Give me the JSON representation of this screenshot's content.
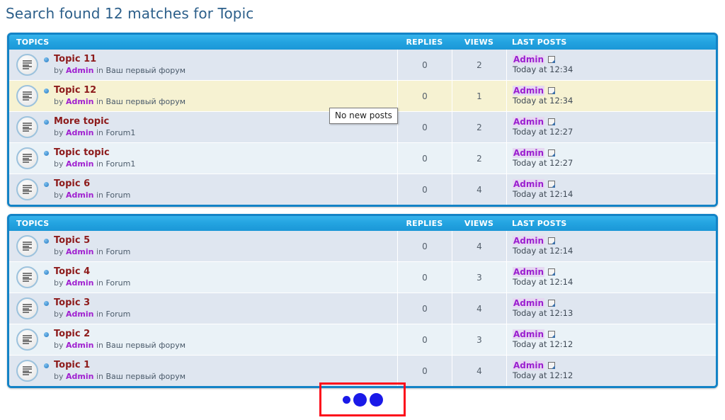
{
  "page": {
    "title": "Search found 12 matches for Topic"
  },
  "tooltip": {
    "text": "No new posts"
  },
  "columns": {
    "topics": "TOPICS",
    "replies": "REPLIES",
    "views": "VIEWS",
    "last_posts": "LAST POSTS"
  },
  "labels": {
    "by": "by",
    "in": "in"
  },
  "colors": {
    "accent": "#1383c6",
    "header_gradient_top": "#35b3ec",
    "title": "#2c5f8a",
    "topic_title": "#8d1b1b",
    "author": "#a020d0",
    "lastpost_author": "#9b1fd0",
    "row_even": "#dfe6f0",
    "row_odd": "#eaf2f7",
    "row_highlight": "#f6f2d2",
    "highlight_box": "#fc0d1b",
    "pagination_dot": "#1a19e8"
  },
  "tables": [
    {
      "id": "table-1",
      "header": "TOPICS",
      "rows": [
        {
          "icon": "topic-no-new-posts-icon",
          "title": "Topic 11",
          "author": "Admin",
          "forum": "Ваш первый форум",
          "replies": "0",
          "views": "2",
          "last_post_author": "Admin",
          "last_post_time": "Today at 12:34",
          "highlight": false
        },
        {
          "icon": "topic-no-new-posts-icon",
          "title": "Topic 12",
          "author": "Admin",
          "forum": "Ваш первый форум",
          "replies": "0",
          "views": "1",
          "last_post_author": "Admin",
          "last_post_time": "Today at 12:34",
          "highlight": true
        },
        {
          "icon": "topic-no-new-posts-icon",
          "title": "More topic",
          "author": "Admin",
          "forum": "Forum1",
          "replies": "0",
          "views": "2",
          "last_post_author": "Admin",
          "last_post_time": "Today at 12:27",
          "highlight": false
        },
        {
          "icon": "topic-no-new-posts-icon",
          "title": "Topic topic",
          "author": "Admin",
          "forum": "Forum1",
          "replies": "0",
          "views": "2",
          "last_post_author": "Admin",
          "last_post_time": "Today at 12:27",
          "highlight": false
        },
        {
          "icon": "topic-no-new-posts-icon",
          "title": "Topic 6",
          "author": "Admin",
          "forum": "Forum",
          "replies": "0",
          "views": "4",
          "last_post_author": "Admin",
          "last_post_time": "Today at 12:14",
          "highlight": false
        }
      ]
    },
    {
      "id": "table-2",
      "header": "TOPICS",
      "rows": [
        {
          "icon": "topic-no-new-posts-icon",
          "title": "Topic 5",
          "author": "Admin",
          "forum": "Forum",
          "replies": "0",
          "views": "4",
          "last_post_author": "Admin",
          "last_post_time": "Today at 12:14",
          "highlight": false
        },
        {
          "icon": "topic-no-new-posts-icon",
          "title": "Topic 4",
          "author": "Admin",
          "forum": "Forum",
          "replies": "0",
          "views": "3",
          "last_post_author": "Admin",
          "last_post_time": "Today at 12:14",
          "highlight": false
        },
        {
          "icon": "topic-no-new-posts-icon",
          "title": "Topic 3",
          "author": "Admin",
          "forum": "Forum",
          "replies": "0",
          "views": "4",
          "last_post_author": "Admin",
          "last_post_time": "Today at 12:13",
          "highlight": false
        },
        {
          "icon": "topic-no-new-posts-icon",
          "title": "Topic 2",
          "author": "Admin",
          "forum": "Ваш первый форум",
          "replies": "0",
          "views": "3",
          "last_post_author": "Admin",
          "last_post_time": "Today at 12:12",
          "highlight": false
        },
        {
          "icon": "topic-no-new-posts-icon",
          "title": "Topic 1",
          "author": "Admin",
          "forum": "Ваш первый форум",
          "replies": "0",
          "views": "4",
          "last_post_author": "Admin",
          "last_post_time": "Today at 12:12",
          "highlight": false
        }
      ]
    }
  ],
  "pagination": {
    "dots": 3
  }
}
